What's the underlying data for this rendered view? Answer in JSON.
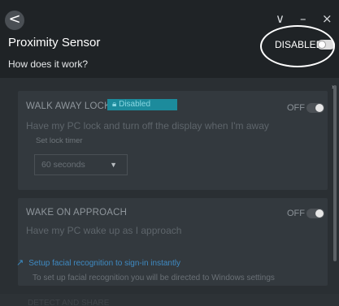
{
  "header": {
    "title": "Proximity Sensor",
    "subtitle": "How does it work?",
    "status_label": "DISABLED",
    "status_on": false,
    "back_glyph": "<",
    "minimize_glyph": "–",
    "close_glyph": "×",
    "collapse_glyph": "∨"
  },
  "walk_away": {
    "title": "WALK AWAY LOCK",
    "badge": "Disabled",
    "description": "Have my PC lock and turn off the display when I'm away",
    "state_label": "OFF",
    "timer_label": "Set lock timer",
    "timer_value": "60 seconds"
  },
  "wake": {
    "title": "WAKE ON APPROACH",
    "description": "Have my PC wake up as I approach",
    "state_label": "OFF",
    "link_text": "Setup facial recognition to sign-in instantly",
    "link_description": "To set up facial recognition you will be directed to Windows settings"
  },
  "footer": {
    "text": "DETECT AND SHARE"
  },
  "colors": {
    "header_bg": "#1f2326",
    "body_bg": "#2a2f33",
    "card_bg": "#33393e",
    "accent_link": "#3f8ac2",
    "badge_bg": "#1c8b9c"
  }
}
